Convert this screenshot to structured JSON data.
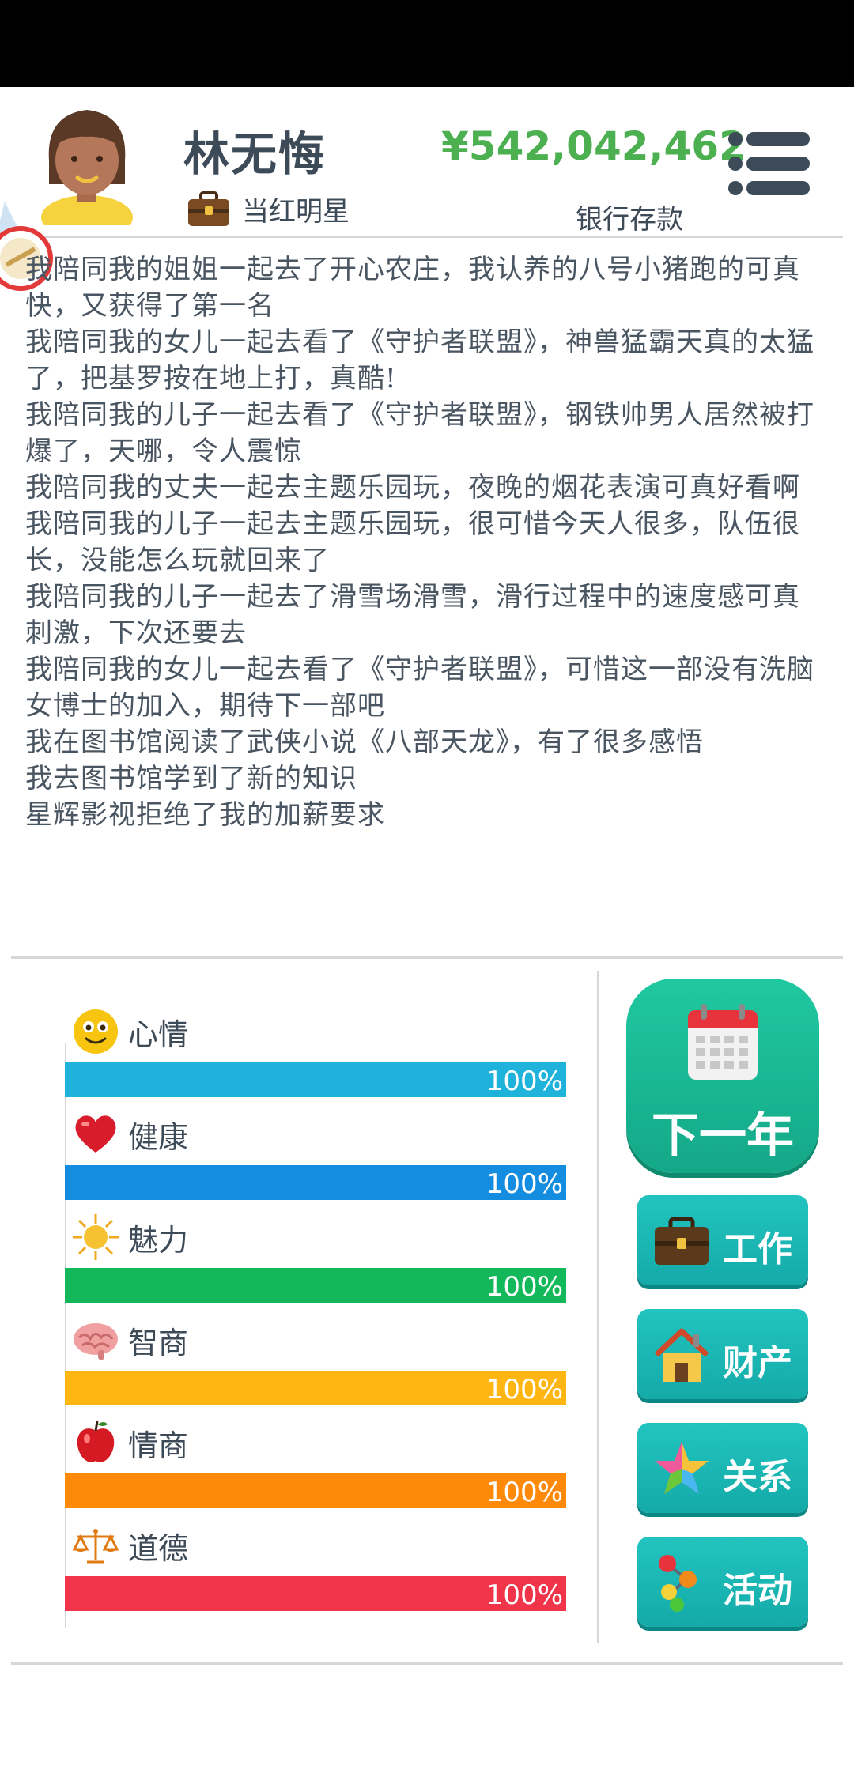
{
  "player": {
    "name": "林无悔",
    "job": "当红明星",
    "money": "¥542,042,462",
    "money_label": "银行存款"
  },
  "log": [
    "我陪同我的姐姐一起去了开心农庄，我认养的八号小猪跑的可真快，又获得了第一名",
    "我陪同我的女儿一起去看了《守护者联盟》，神兽猛霸天真的太猛了，把基罗按在地上打，真酷!",
    "我陪同我的儿子一起去看了《守护者联盟》，钢铁帅男人居然被打爆了，天哪，令人震惊",
    "我陪同我的丈夫一起去主题乐园玩，夜晚的烟花表演可真好看啊",
    "我陪同我的儿子一起去主题乐园玩，很可惜今天人很多，队伍很长，没能怎么玩就回来了",
    "我陪同我的儿子一起去了滑雪场滑雪，滑行过程中的速度感可真刺激，下次还要去",
    "我陪同我的女儿一起去看了《守护者联盟》，可惜这一部没有洗脑女博士的加入，期待下一部吧",
    "我在图书馆阅读了武侠小说《八部天龙》，有了很多感悟",
    "我去图书馆学到了新的知识",
    "星辉影视拒绝了我的加薪要求"
  ],
  "stats": [
    {
      "label": "心情",
      "value": "100%",
      "fraction": 1.0,
      "color": "#1fb2da",
      "icon": "smiley-icon"
    },
    {
      "label": "健康",
      "value": "100%",
      "fraction": 1.0,
      "color": "#148ce0",
      "icon": "heart-icon"
    },
    {
      "label": "魅力",
      "value": "100%",
      "fraction": 1.0,
      "color": "#12b85a",
      "icon": "sun-icon"
    },
    {
      "label": "智商",
      "value": "100%",
      "fraction": 1.0,
      "color": "#ffb612",
      "icon": "brain-icon"
    },
    {
      "label": "情商",
      "value": "100%",
      "fraction": 1.0,
      "color": "#ff8a0a",
      "icon": "apple-icon"
    },
    {
      "label": "道德",
      "value": "100%",
      "fraction": 1.0,
      "color": "#f0344a",
      "icon": "scales-icon"
    }
  ],
  "buttons": {
    "next_year": "下一年",
    "work": "工作",
    "property": "财产",
    "relations": "关系",
    "activities": "活动"
  }
}
